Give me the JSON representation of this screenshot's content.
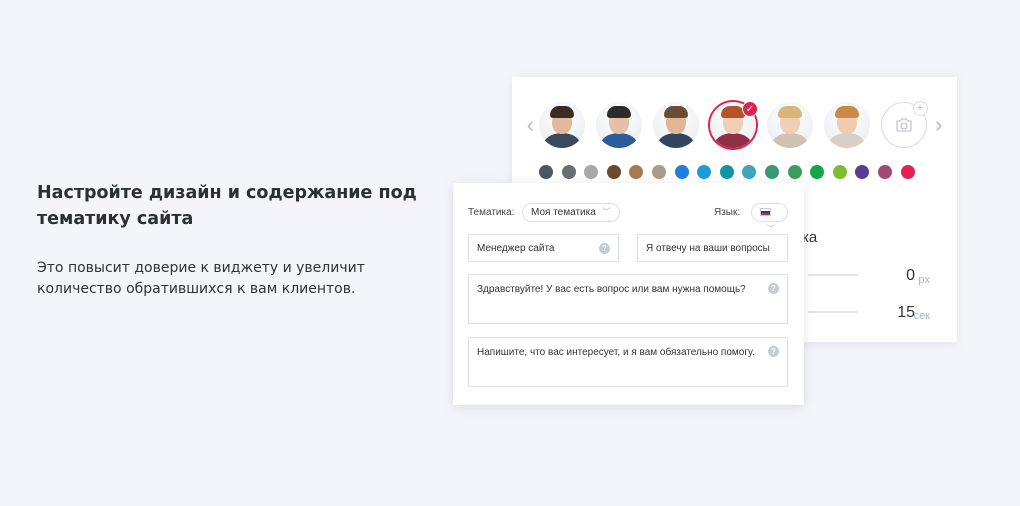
{
  "promo": {
    "title": "Настройте дизайн и содержание под тематику сайта",
    "description": "Это повысит доверие к виджету и увеличит количество обратившихся к вам клиентов."
  },
  "design": {
    "avatars": [
      {
        "skin": "#e2b99a",
        "hair": "#3a2c25",
        "shirt": "#3b4a5c"
      },
      {
        "skin": "#e6c0a3",
        "hair": "#2d2b2a",
        "shirt": "#2a5d9a"
      },
      {
        "skin": "#e1b596",
        "hair": "#6b4d33",
        "shirt": "#34465f"
      },
      {
        "skin": "#f0cdb3",
        "hair": "#b5532a",
        "shirt": "#8e3146"
      },
      {
        "skin": "#f0cfb6",
        "hair": "#d8b57a",
        "shirt": "#cfc2b2"
      },
      {
        "skin": "#efcbb0",
        "hair": "#c88a46",
        "shirt": "#d8d0c6"
      }
    ],
    "selected_avatar_index": 3,
    "colors": [
      "#4b5563",
      "#6b6e72",
      "#a7a9ac",
      "#6b4a2f",
      "#a57c52",
      "#a59e8a",
      "#1f7fde",
      "#1d9bd9",
      "#1494a7",
      "#3fa5bf",
      "#3a9a73",
      "#3d9c5c",
      "#12a84a",
      "#7dbd31",
      "#5a3e94",
      "#a04a73",
      "#e0234e"
    ],
    "label_fragment": "ка",
    "offset_value": "0",
    "offset_unit": "px",
    "delay_value": "15",
    "delay_unit": "сек"
  },
  "content": {
    "topic_label": "Тематика:",
    "topic_value": "Моя тематика",
    "language_label": "Язык:",
    "operator_title": "Менеджер сайта",
    "operator_subtitle": "Я отвечу на ваши вопросы",
    "greeting": "Здравствуйте! У вас есть вопрос или вам нужна помощь?",
    "input_prompt": "Напишите, что вас интересует, и я вам обязательно помогу."
  }
}
